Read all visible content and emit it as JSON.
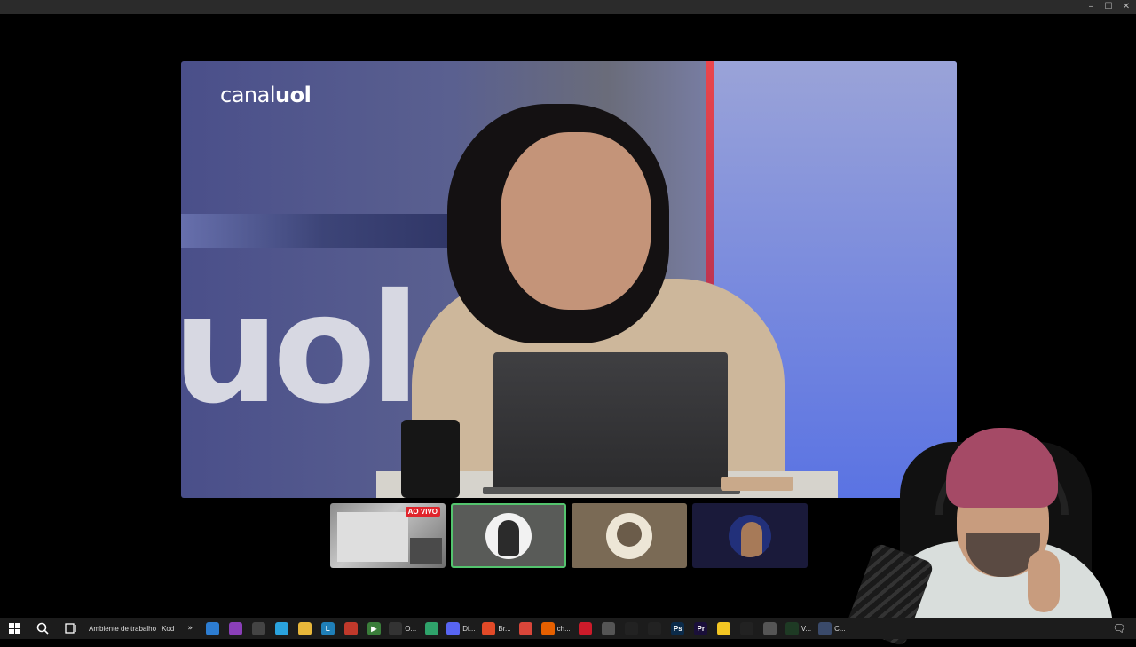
{
  "window": {
    "controls": {
      "minimize": "–",
      "maximize": "☐",
      "close": "✕"
    }
  },
  "stream": {
    "channel_logo_left": "canal",
    "channel_logo_right": "uol",
    "set_background_text": "uol"
  },
  "thumbnails": [
    {
      "name": "live-screen",
      "badge": "AO VIVO"
    },
    {
      "name": "avatar-hat-man",
      "selected": true
    },
    {
      "name": "avatar-engraving"
    },
    {
      "name": "avatar-dark-portrait"
    }
  ],
  "taskbar": {
    "desktop_label": "Ambiente de trabalho",
    "kod_label": "Kod",
    "overflow_label": "»",
    "apps": [
      {
        "icon": "app-icon",
        "color": "#2d7dd2",
        "glyph": ""
      },
      {
        "icon": "app-icon",
        "color": "#8a3fb8",
        "glyph": ""
      },
      {
        "icon": "app-icon",
        "color": "#444444",
        "glyph": ""
      },
      {
        "icon": "telegram-icon",
        "color": "#2aa3de",
        "glyph": ""
      },
      {
        "icon": "folder-icon",
        "color": "#e8b73a",
        "glyph": ""
      },
      {
        "icon": "app-icon",
        "color": "#1f7fb8",
        "glyph": "L"
      },
      {
        "icon": "app-icon",
        "color": "#c0392b",
        "glyph": ""
      },
      {
        "icon": "play-icon",
        "color": "#3a7d3a",
        "glyph": "▶"
      },
      {
        "icon": "obs-icon",
        "color": "#333333",
        "glyph": "",
        "label": "O..."
      },
      {
        "icon": "app-icon",
        "color": "#2fa36b",
        "glyph": ""
      },
      {
        "icon": "discord-icon",
        "color": "#5865f2",
        "glyph": "",
        "label": "Di..."
      },
      {
        "icon": "brave-icon",
        "color": "#e24a28",
        "glyph": "",
        "label": "Br..."
      },
      {
        "icon": "chrome-icon",
        "color": "#d9463a",
        "glyph": ""
      },
      {
        "icon": "firefox-icon",
        "color": "#e66000",
        "glyph": "",
        "label": "ch..."
      },
      {
        "icon": "opera-icon",
        "color": "#cc1b2a",
        "glyph": ""
      },
      {
        "icon": "shield-icon",
        "color": "#555555",
        "glyph": ""
      },
      {
        "icon": "capcut-icon",
        "color": "#222222",
        "glyph": ""
      },
      {
        "icon": "app-icon",
        "color": "#222222",
        "glyph": ""
      },
      {
        "icon": "photoshop-icon",
        "color": "#0b2b4a",
        "glyph": "Ps"
      },
      {
        "icon": "premiere-icon",
        "color": "#1a0f3a",
        "glyph": "Pr"
      },
      {
        "icon": "sticky-notes-icon",
        "color": "#f3c623",
        "glyph": ""
      },
      {
        "icon": "steam-icon",
        "color": "#222222",
        "glyph": ""
      },
      {
        "icon": "calculator-icon",
        "color": "#555555",
        "glyph": ""
      },
      {
        "icon": "terminal-icon",
        "color": "#1e3a24",
        "glyph": "",
        "label": "V..."
      },
      {
        "icon": "app-icon",
        "color": "#3a4a6a",
        "glyph": "",
        "label": "C..."
      }
    ],
    "notification_glyph": "🗨"
  }
}
